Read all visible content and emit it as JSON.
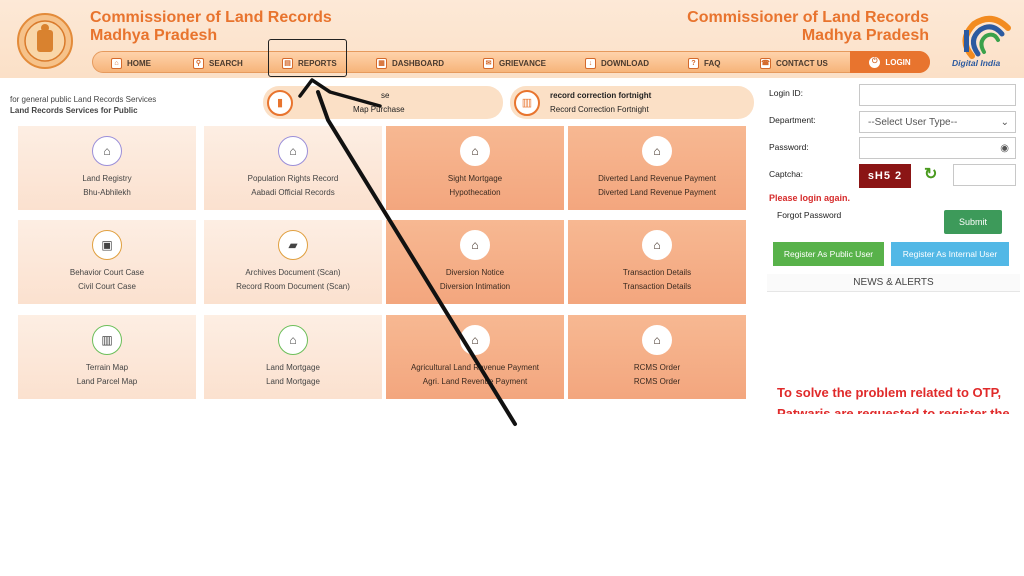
{
  "header": {
    "title_left_1": "Commissioner of Land Records",
    "title_left_2": "Madhya Pradesh",
    "title_right_1": "Commissioner of Land Records",
    "title_right_2": "Madhya Pradesh",
    "digital_india": "Digital India"
  },
  "nav": {
    "items": [
      {
        "label": "HOME",
        "icon": "home-icon"
      },
      {
        "label": "SEARCH",
        "icon": "search-icon"
      },
      {
        "label": "REPORTS",
        "icon": "report-icon"
      },
      {
        "label": "DASHBOARD",
        "icon": "dashboard-icon"
      },
      {
        "label": "GRIEVANCE",
        "icon": "grievance-icon"
      },
      {
        "label": "DOWNLOAD",
        "icon": "download-icon"
      },
      {
        "label": "FAQ",
        "icon": "faq-icon"
      },
      {
        "label": "CONTACT US",
        "icon": "contact-icon"
      },
      {
        "label": "LOGIN",
        "icon": "login-icon"
      }
    ]
  },
  "info": {
    "line1": "for general public Land Records Services",
    "line2": "Land Records Services for Public"
  },
  "pills": [
    {
      "line1": "",
      "line2": "Map Purchase",
      "line1_suffix": "se",
      "icon": "map-icon"
    },
    {
      "line1": "record correction fortnight",
      "line2": "Record Correction Fortnight",
      "icon": "calendar-icon"
    }
  ],
  "cards": [
    {
      "line1": "Land Registry",
      "line2": "Bhu-Abhilekh"
    },
    {
      "line1": "Population Rights Record",
      "line2": "Aabadi Official Records"
    },
    {
      "line1": "Sight Mortgage",
      "line2": "Hypothecation"
    },
    {
      "line1": "Diverted Land Revenue Payment",
      "line2": "Diverted Land Revenue Payment"
    },
    {
      "line1": "Behavior Court Case",
      "line2": "Civil Court Case"
    },
    {
      "line1": "Archives Document (Scan)",
      "line2": "Record Room Document (Scan)"
    },
    {
      "line1": "Diversion Notice",
      "line2": "Diversion Intimation"
    },
    {
      "line1": "Transaction Details",
      "line2": "Transaction Details"
    },
    {
      "line1": "Terrain Map",
      "line2": "Land Parcel Map"
    },
    {
      "line1": "Land Mortgage",
      "line2": "Land Mortgage"
    },
    {
      "line1": "Agricultural Land Revenue Payment",
      "line2": "Agri. Land Revenue Payment"
    },
    {
      "line1": "RCMS Order",
      "line2": "RCMS Order"
    }
  ],
  "login": {
    "login_id_label": "Login ID:",
    "department_label": "Department:",
    "department_value": "--Select User Type--",
    "password_label": "Password:",
    "captcha_label": "Captcha:",
    "captcha_text": "sH5 2",
    "error": "Please login again.",
    "forgot": "Forgot Password",
    "submit": "Submit",
    "register_public": "Register As Public User",
    "register_internal": "Register As Internal User"
  },
  "news": {
    "title": "NEWS & ALERTS",
    "text": "To solve the problem related to OTP, Patwaris are requested to register the"
  },
  "colors": {
    "brand_orange": "#e8742e",
    "nav_bg": "#f6b47a",
    "error_red": "#d62b2b",
    "submit_green": "#3d9a5a"
  }
}
